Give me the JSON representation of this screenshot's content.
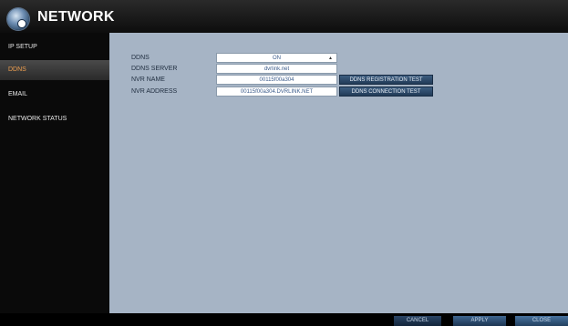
{
  "header": {
    "title": "NETWORK"
  },
  "sidebar": {
    "items": [
      {
        "label": "IP SETUP"
      },
      {
        "label": "DDNS"
      },
      {
        "label": "EMAIL"
      },
      {
        "label": "NETWORK STATUS"
      }
    ],
    "active_index": 1
  },
  "form": {
    "ddns": {
      "label": "DDNS",
      "value": "ON"
    },
    "ddns_server": {
      "label": "DDNS SERVER",
      "value": "dvrlink.net"
    },
    "nvr_name": {
      "label": "NVR NAME",
      "value": "00115f00a304"
    },
    "nvr_address": {
      "label": "NVR ADDRESS",
      "value": "00115f00a304.DVRLINK.NET"
    }
  },
  "buttons": {
    "registration_test": "DDNS REGISTRATION TEST",
    "connection_test": "DDNS CONNECTION TEST"
  },
  "footer": {
    "cancel": "CANCEL",
    "apply": "APPLY",
    "close": "CLOSE"
  },
  "colors": {
    "panel_bg": "#a6b4c5",
    "active_item_text": "#f0a050",
    "button_bg": "#2d4a6b"
  }
}
